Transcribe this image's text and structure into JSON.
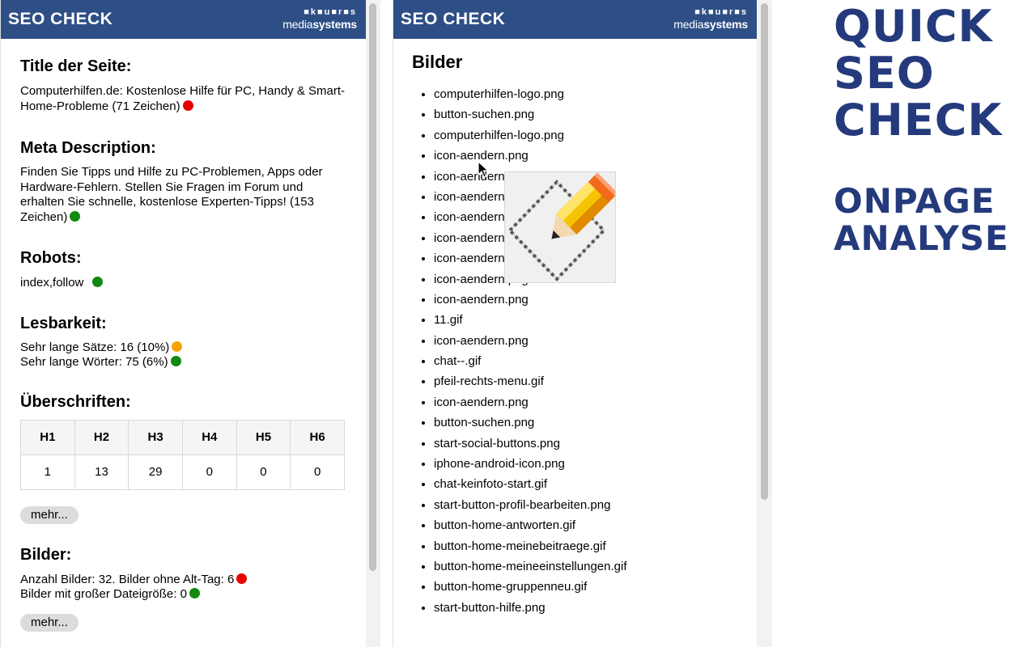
{
  "brand": {
    "logo": "SEO CHECK",
    "dots": "■k■u■r■s",
    "name_light": "media",
    "name_bold": "systems"
  },
  "left": {
    "title_heading": "Title der Seite:",
    "title_text": "Computerhilfen.de: Kostenlose Hilfe für PC, Handy & Smart-Home-Probleme (71 Zeichen)",
    "title_status_color": "#e60000",
    "meta_heading": "Meta Description:",
    "meta_text": "Finden Sie Tipps und Hilfe zu PC-Problemen, Apps oder Hardware-Fehlern. Stellen Sie Fragen im Forum und erhalten Sie schnelle, kostenlose Experten-Tipps! (153 Zeichen)",
    "meta_status_color": "#118a11",
    "robots_heading": "Robots:",
    "robots_text": "index,follow",
    "robots_status_color": "#118a11",
    "lesbarkeit_heading": "Lesbarkeit:",
    "saetze_text": "Sehr lange Sätze: 16 (10%)",
    "saetze_status_color": "#f5a300",
    "woerter_text": "Sehr lange Wörter: 75 (6%)",
    "woerter_status_color": "#118a11",
    "headings_heading": "Überschriften:",
    "headings_table": {
      "headers": [
        "H1",
        "H2",
        "H3",
        "H4",
        "H5",
        "H6"
      ],
      "values": [
        "1",
        "13",
        "29",
        "0",
        "0",
        "0"
      ]
    },
    "mehr_label": "mehr...",
    "bilder_heading": "Bilder:",
    "bilder_count_text": "Anzahl Bilder: 32. Bilder ohne Alt-Tag: 6",
    "bilder_count_status_color": "#e60000",
    "bilder_size_text": "Bilder mit großer Dateigröße: 0",
    "bilder_size_status_color": "#118a11",
    "mehr_label_2": "mehr..."
  },
  "middle": {
    "heading": "Bilder",
    "images": [
      "computerhilfen-logo.png",
      "button-suchen.png",
      "computerhilfen-logo.png",
      "icon-aendern.png",
      "icon-aendern.png",
      "icon-aendern.png",
      "icon-aendern.png",
      "icon-aendern.png",
      "icon-aendern.png",
      "icon-aendern.png",
      "icon-aendern.png",
      "11.gif",
      "icon-aendern.png",
      "chat--.gif",
      "pfeil-rechts-menu.gif",
      "icon-aendern.png",
      "button-suchen.png",
      "start-social-buttons.png",
      "iphone-android-icon.png",
      "chat-keinfoto-start.gif",
      "start-button-profil-bearbeiten.png",
      "button-home-antworten.gif",
      "button-home-meinebeitraege.gif",
      "button-home-meineeinstellungen.gif",
      "button-home-gruppenneu.gif",
      "start-button-hilfe.png"
    ]
  },
  "poster": {
    "line1": "QUICK",
    "line2": "SEO",
    "line3": "CHECK",
    "line4": "ONPAGE",
    "line5": "ANALYSE"
  }
}
